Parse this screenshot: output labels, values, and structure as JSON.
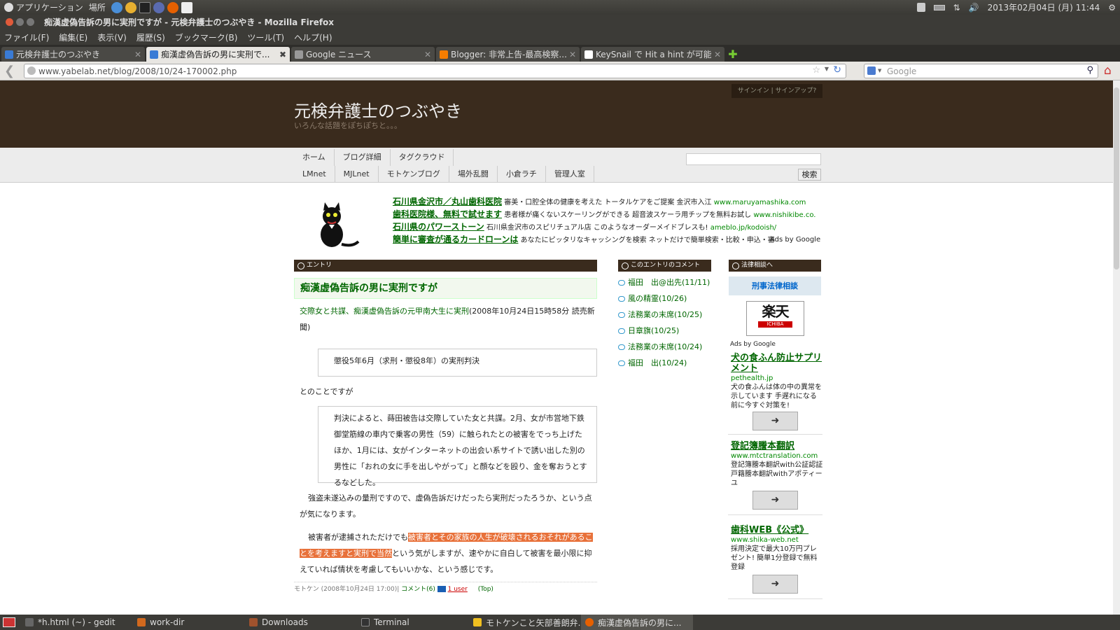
{
  "system_bar": {
    "menu_applications": "アプリケーション",
    "menu_places": "場所",
    "datetime": "2013年02月04日 (月) 11:44"
  },
  "window": {
    "title": "痴漢虚偽告訴の男に実刑ですが - 元検弁護士のつぶやき - Mozilla Firefox"
  },
  "menu": [
    "ファイル(F)",
    "編集(E)",
    "表示(V)",
    "履歴(S)",
    "ブックマーク(B)",
    "ツール(T)",
    "ヘルプ(H)"
  ],
  "tabs": [
    {
      "label": "元検弁護士のつぶやき",
      "color": "#3a7bd5"
    },
    {
      "label": "痴漢虚偽告訴の男に実刑で...",
      "color": "#3a7bd5"
    },
    {
      "label": "Google ニュース",
      "color": "#999999"
    },
    {
      "label": "Blogger: 非常上告-最高検察...",
      "color": "#f57d00"
    },
    {
      "label": "KeySnail で Hit a hint が可能...",
      "color": "#ffffff"
    }
  ],
  "nav": {
    "url": "www.yabelab.net/blog/2008/10/24-170002.php",
    "search_placeholder": "Google"
  },
  "blog": {
    "title": "元検弁護士のつぶやき",
    "subtitle": "いろんな話題をぽちぽちと。。。",
    "signin": "サインイン | サインアップ?",
    "nav_row1": [
      "ホーム",
      "ブログ詳細",
      "タグクラウド"
    ],
    "nav_row2": [
      "LMnet",
      "MJLnet",
      "モトケンブログ",
      "場外乱闘",
      "小倉ラチ",
      "管理人室"
    ],
    "search_button": "検索"
  },
  "ads_top": [
    {
      "title": "石川県金沢市／丸山歯科医院",
      "text": "審美・口腔全体の健康を考えた トータルケアをご提案 金沢市入江",
      "url": "www.maruyamashika.com"
    },
    {
      "title": "歯科医院様、無料で試せます",
      "text": "患者様が痛くないスケーリングができる 超音波スケーラ用チップを無料お試し",
      "url": "www.nishikibe.co."
    },
    {
      "title": "石川県のパワーストーン",
      "text": "石川県金沢市のスピリチュアル店 このようなオーダーメイドブレスも!",
      "url": "ameblo.jp/kodoish/"
    },
    {
      "title": "簡単に審査が通るカードローンは",
      "text": "あなたにピッタリなキャッシングを検索 ネットだけで簡単検索・比較・申込・審",
      "url": ""
    }
  ],
  "ads_by": "Ads by Google",
  "entry": {
    "section": "エントリ",
    "title": "痴漢虚偽告訴の男に実刑ですが",
    "link_text": "交際女と共謀、痴漢虚偽告訴の元甲南大生に実刑",
    "source_text": "(2008年10月24日15時58分 読売新聞)",
    "quote1": "懲役5年6月（求刑・懲役8年）の実刑判決",
    "para1": "とのことですが",
    "quote2": "判決によると、蒔田被告は交際していた女と共謀。2月、女が市営地下鉄御堂筋線の車内で乗客の男性（59）に触られたとの被害をでっち上げたほか、1月には、女がインターネットの出会い系サイトで誘い出した別の男性に「おれの女に手を出しやがって」と顔などを殴り、金を奪おうとするなどした。",
    "para2": "強盗未遂込みの量刑ですので、虚偽告訴だけだったら実刑だったろうか、という点が気になります。",
    "para3_a": "被害者が逮捕されただけでも",
    "para3_hl": "被害者とその家族の人生が破壊されるおそれがあることを考えますと実刑で当然",
    "para3_b": "という気がしますが、速やかに自白して被害を最小限に抑えていれば情状を考慮してもいいかな、という感じです。",
    "footer_author": "モトケン (2008年10月24日 17:00)",
    "footer_comments": "コメント(6)",
    "footer_users": "1 user",
    "footer_top": "(Top)"
  },
  "comments": {
    "section": "このエントリのコメント",
    "items": [
      "福田　出@出先(11/11)",
      "風の精霊(10/26)",
      "法務業の末席(10/25)",
      "日章旗(10/25)",
      "法務業の末席(10/24)",
      "福田　出(10/24)"
    ]
  },
  "legal": {
    "section": "法律相談へ",
    "crime_link": "刑事法律相談",
    "rakuten": "楽天",
    "rakuten_sub": "ICHIBA",
    "ads_by": "Ads by Google",
    "ads": [
      {
        "title": "犬の食ふん防止サプリメント",
        "url": "pethealth.jp",
        "text": "犬の食ふんは体の中の異常を示しています 手遅れになる前に今すぐ対策を!"
      },
      {
        "title": "登記簿謄本翻訳",
        "url": "www.mtctranslation.com",
        "text": "登記簿謄本翻訳with公証認証 戸籍謄本翻訳withアポティーユ"
      },
      {
        "title": "歯科WEB《公式》",
        "url": "www.shika-web.net",
        "text": "採用決定で最大10万円プレゼント! 簡単1分登録で無料登録"
      }
    ]
  },
  "taskbar": [
    {
      "label": "*h.html (~) - gedit",
      "color": "#666666"
    },
    {
      "label": "work-dir",
      "color": "#d2691e"
    },
    {
      "label": "Downloads",
      "color": "#a0522d"
    },
    {
      "label": "Terminal",
      "color": "#333333"
    },
    {
      "label": "モトケンこと矢部善朗弁...",
      "color": "#f0c020"
    },
    {
      "label": "痴漢虚偽告訴の男に...",
      "color": "#e66000"
    }
  ]
}
